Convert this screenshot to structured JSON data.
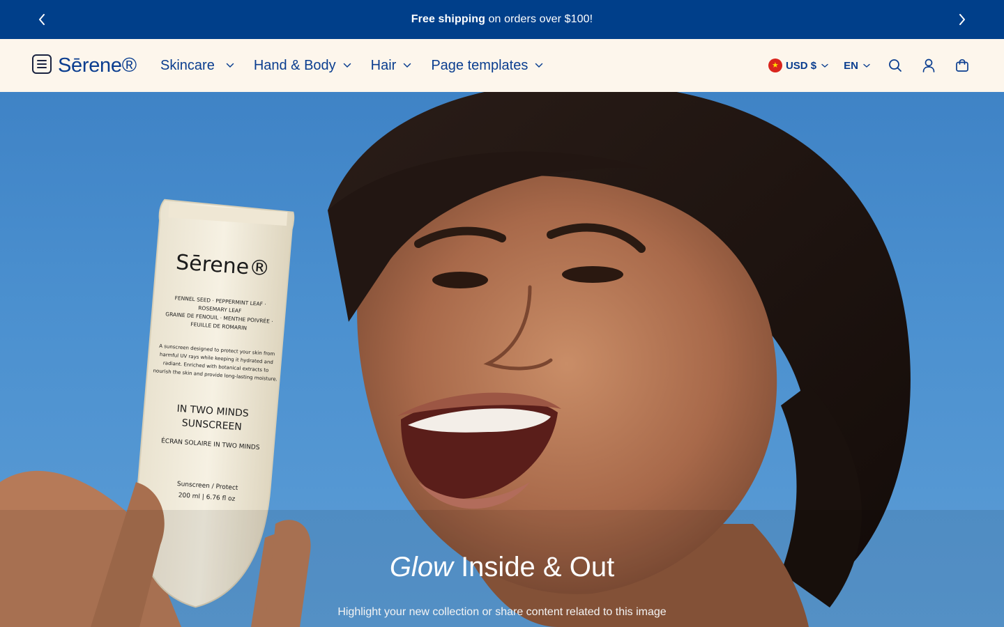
{
  "announcement": {
    "bold": "Free shipping",
    "rest": " on orders over $100!"
  },
  "header": {
    "logo": "Sērene®",
    "nav": [
      {
        "label": "Skincare"
      },
      {
        "label": "Hand & Body"
      },
      {
        "label": "Hair"
      },
      {
        "label": "Page templates"
      }
    ],
    "currency": "USD $",
    "language": "EN"
  },
  "hero": {
    "title_italic": "Glow",
    "title_rest": " Inside & Out",
    "subtitle": "Highlight your new collection or share content related to this image",
    "product": {
      "brand": "Sērene®",
      "ingredients_1": "FENNEL SEED · PEPPERMINT LEAF ·",
      "ingredients_2": "ROSEMARY LEAF",
      "ingredients_3": "GRAINE DE FENOUIL · MENTHE POIVRÉE ·",
      "ingredients_4": "FEUILLE DE ROMARIN",
      "desc_1": "A sunscreen designed to protect your skin from",
      "desc_2": "harmful UV rays while keeping it hydrated and",
      "desc_3": "radiant. Enriched with botanical extracts to",
      "desc_4": "nourish the skin and provide long-lasting moisture.",
      "name_1": "IN TWO MINDS",
      "name_2": "SUNSCREEN",
      "name_fr": "ÉCRAN SOLAIRE IN TWO MINDS",
      "type": "Sunscreen / Protect",
      "size": "200 ml | 6.76 fl oz"
    }
  },
  "colors": {
    "announcement_bg": "#003f8a",
    "header_bg": "#fdf6ec",
    "brand_blue": "#0a3d8f"
  }
}
